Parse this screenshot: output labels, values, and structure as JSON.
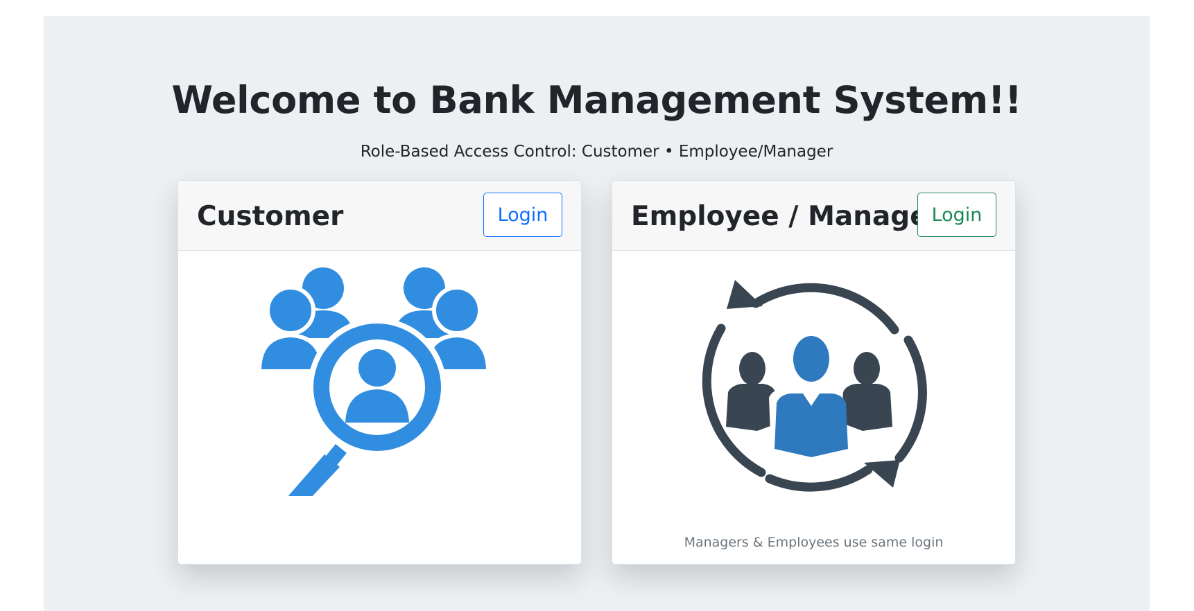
{
  "hero": {
    "title": "Welcome to Bank Management System!!",
    "subtitle": "Role-Based Access Control: Customer • Employee/Manager"
  },
  "cards": [
    {
      "title": "Customer",
      "login_label": "Login",
      "button_color": "#0d6efd",
      "icon": "customer-search-icon",
      "icon_color": "#318ddf"
    },
    {
      "title": "Employee / Manager",
      "login_label": "Login",
      "button_color": "#198754",
      "icon": "team-cycle-icon",
      "icon_color": "#3a4552",
      "accent_color": "#2f79bf",
      "note": "Managers & Employees use same login"
    }
  ],
  "colors": {
    "background": "#ecf0f3",
    "card_header": "#f7f7f7"
  }
}
